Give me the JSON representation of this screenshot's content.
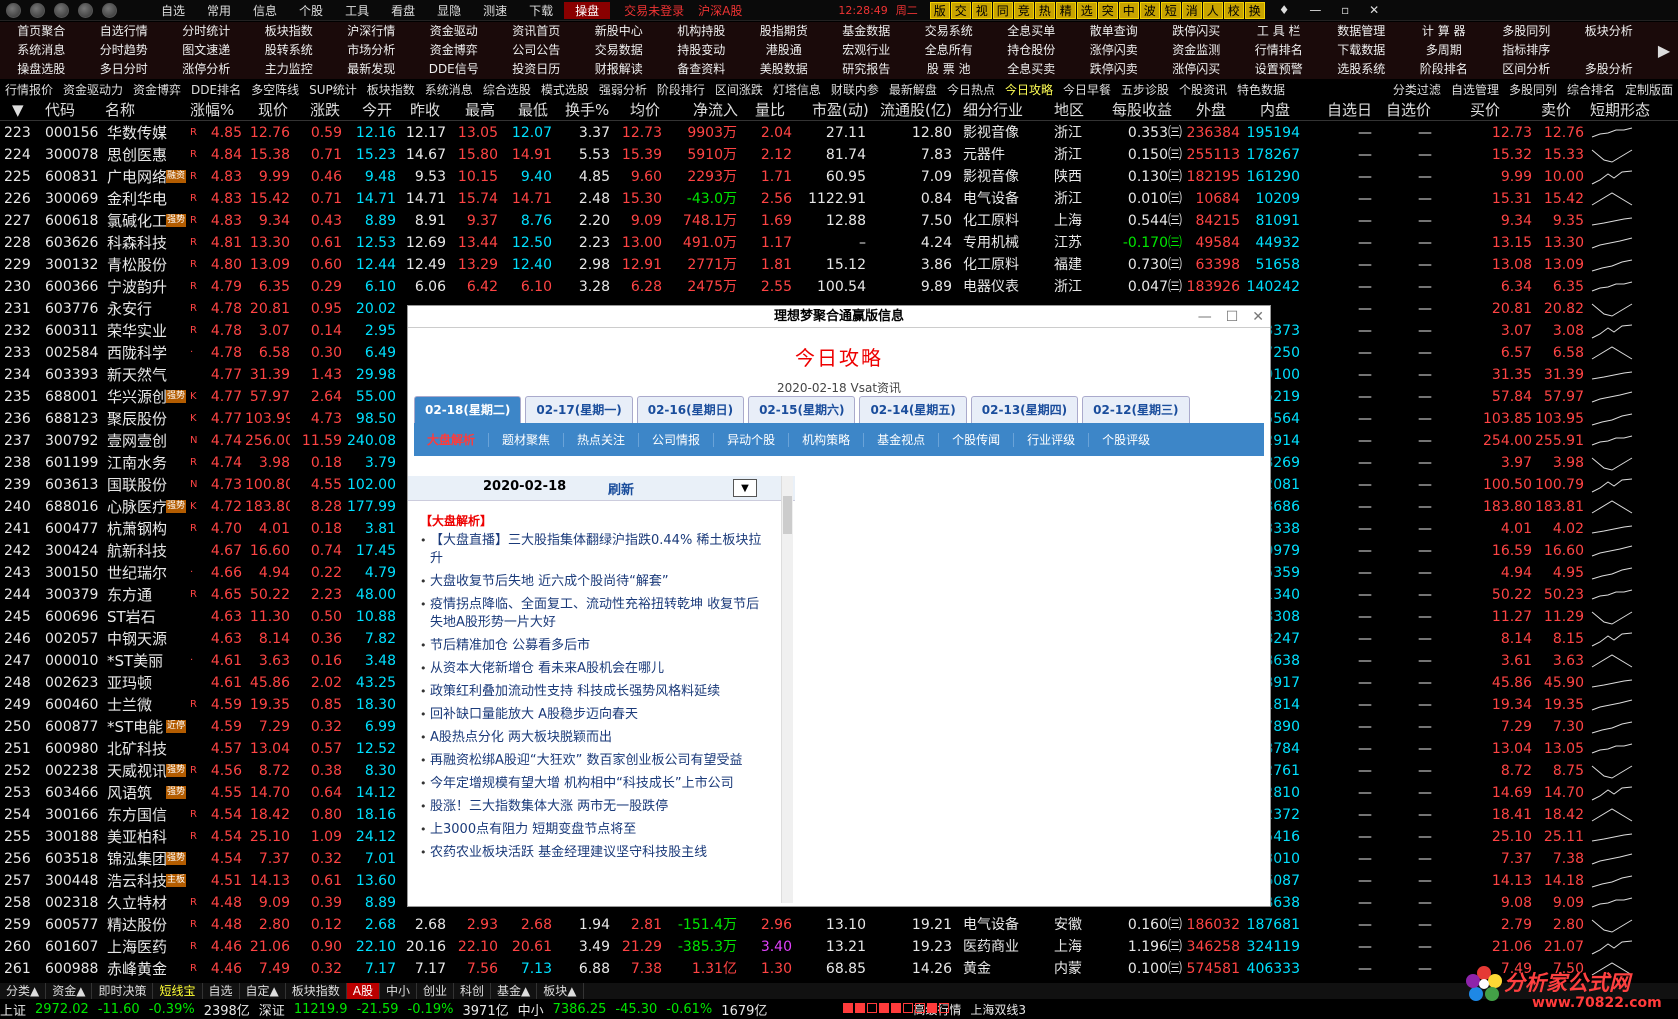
{
  "topbar": {
    "menu": [
      "自选",
      "常用",
      "信息",
      "个股",
      "工具",
      "看盘",
      "显隐",
      "测速",
      "下载",
      "操盘"
    ],
    "active_menu": "操盘",
    "login": "交易未登录",
    "market": "沪深A股",
    "time": "12:28:49",
    "weekday": "周二",
    "quick_buttons": [
      "版",
      "交",
      "视",
      "同",
      "竞",
      "热",
      "精",
      "选",
      "突",
      "中",
      "波",
      "短",
      "消",
      "人",
      "校",
      "换"
    ]
  },
  "menu_grid": [
    [
      "首页聚合",
      "自选行情",
      "分时统计",
      "板块指数",
      "沪深行情",
      "资金驱动",
      "资讯首页",
      "新股中心",
      "机构持股",
      "股指期货",
      "基金数据",
      "交易系统",
      "全息买单",
      "散单查询",
      "跌停闪买",
      "工 具 栏",
      "数据管理",
      "计 算 器",
      "多股同列",
      "板块分析"
    ],
    [
      "系统消息",
      "分时趋势",
      "图文速递",
      "股转系统",
      "市场分析",
      "资金博弈",
      "公司公告",
      "交易数据",
      "持股变动",
      "港股通",
      "宏观行业",
      "全息所有",
      "持仓股份",
      "涨停闪卖",
      "资金监测",
      "行情排名",
      "下载数据",
      "多周期",
      "指标排序",
      ""
    ],
    [
      "操盘选股",
      "多日分时",
      "涨停分析",
      "主力监控",
      "最新发现",
      "DDE信号",
      "投资日历",
      "财报解读",
      "备查资料",
      "美股数据",
      "研究报告",
      "股 票 池",
      "全息买卖",
      "跌停闪卖",
      "涨停闪买",
      "设置预警",
      "选股系统",
      "阶段排名",
      "区间分析",
      "多股分析"
    ]
  ],
  "subbar_left": [
    "行情报价",
    "资金驱动力",
    "资金博弈",
    "DDE排名",
    "多空阵线",
    "SUP统计",
    "板块指数",
    "系统消息",
    "综合选股",
    "模式选股",
    "强弱分析",
    "阶段排行",
    "区间涨跌",
    "灯塔信息",
    "财联内参",
    "最新解盘",
    "今日热点",
    "今日攻略",
    "今日早餐",
    "五步诊股",
    "个股资讯",
    "特色数据"
  ],
  "subbar_active": "今日攻略",
  "subbar_right": [
    "分类过滤",
    "自选管理",
    "多股同列",
    "综合排名",
    "定制版面"
  ],
  "table_headers": [
    "代码",
    "名称",
    "涨幅%",
    "现价",
    "涨跌",
    "今开",
    "昨收",
    "最高",
    "最低",
    "换手%",
    "均价",
    "净流入",
    "量比",
    "市盈(动)",
    "流通股(亿)",
    "细分行业",
    "地区",
    "每股收益",
    "外盘",
    "内盘",
    "自选日",
    "自选价",
    "买价",
    "卖价",
    "短期形态"
  ],
  "rows": [
    {
      "n": "223",
      "code": "000156",
      "name": "华数传媒",
      "mark": "R",
      "pct": "4.85",
      "price": "12.76",
      "chg": "0.59",
      "open": "12.16",
      "prev": "12.17",
      "high": "13.05",
      "low": "12.07",
      "turn": "3.37",
      "avg": "12.73",
      "flow": "9903万",
      "vr": "2.04",
      "pe": "27.11",
      "fl": "12.80",
      "ind": "影视音像",
      "area": "浙江",
      "eps": "0.353㈢",
      "out": "236384",
      "in": "195194",
      "buy": "12.73",
      "sell": "12.76"
    },
    {
      "n": "224",
      "code": "300078",
      "name": "思创医惠",
      "mark": "R",
      "pct": "4.84",
      "price": "15.38",
      "chg": "0.71",
      "open": "15.23",
      "prev": "14.67",
      "high": "15.80",
      "low": "14.91",
      "turn": "5.53",
      "avg": "15.39",
      "flow": "5910万",
      "vr": "2.12",
      "pe": "81.74",
      "fl": "7.83",
      "ind": "元器件",
      "area": "浙江",
      "eps": "0.150㈢",
      "out": "255113",
      "in": "178267",
      "buy": "15.32",
      "sell": "15.33"
    },
    {
      "n": "225",
      "code": "600831",
      "name": "广电网络",
      "tag": "融资",
      "mark": "R",
      "pct": "4.83",
      "price": "9.99",
      "chg": "0.46",
      "open": "9.48",
      "prev": "9.53",
      "high": "10.15",
      "low": "9.40",
      "turn": "4.85",
      "avg": "9.60",
      "flow": "2293万",
      "vr": "1.71",
      "pe": "60.95",
      "fl": "7.09",
      "ind": "影视音像",
      "area": "陕西",
      "eps": "0.130㈢",
      "out": "182195",
      "in": "161290",
      "buy": "9.99",
      "sell": "10.00"
    },
    {
      "n": "226",
      "code": "300069",
      "name": "金利华电",
      "mark": "R",
      "pct": "4.83",
      "price": "15.42",
      "chg": "0.71",
      "open": "14.71",
      "prev": "14.71",
      "high": "15.74",
      "low": "14.71",
      "turn": "2.48",
      "avg": "15.30",
      "flow": "-43.0万",
      "vr": "2.56",
      "pe": "1122.91",
      "fl": "0.84",
      "ind": "电气设备",
      "area": "浙江",
      "eps": "0.010㈢",
      "out": "10684",
      "in": "10209",
      "buy": "15.31",
      "sell": "15.42"
    },
    {
      "n": "227",
      "code": "600618",
      "name": "氯碱化工",
      "tag": "强势",
      "mark": "R",
      "pct": "4.83",
      "price": "9.34",
      "chg": "0.43",
      "open": "8.89",
      "prev": "8.91",
      "high": "9.37",
      "low": "8.76",
      "turn": "2.20",
      "avg": "9.09",
      "flow": "748.1万",
      "vr": "1.69",
      "pe": "12.88",
      "fl": "7.50",
      "ind": "化工原料",
      "area": "上海",
      "eps": "0.544㈢",
      "out": "84215",
      "in": "81091",
      "buy": "9.34",
      "sell": "9.35"
    },
    {
      "n": "228",
      "code": "603626",
      "name": "科森科技",
      "mark": "R",
      "pct": "4.81",
      "price": "13.30",
      "chg": "0.61",
      "open": "12.53",
      "prev": "12.69",
      "high": "13.44",
      "low": "12.50",
      "turn": "2.23",
      "avg": "13.00",
      "flow": "491.0万",
      "vr": "1.17",
      "pe": "–",
      "fl": "4.24",
      "ind": "专用机械",
      "area": "江苏",
      "eps": "-0.170㈢",
      "out": "49584",
      "in": "44932",
      "buy": "13.15",
      "sell": "13.30"
    },
    {
      "n": "229",
      "code": "300132",
      "name": "青松股份",
      "mark": "R",
      "pct": "4.80",
      "price": "13.09",
      "chg": "0.60",
      "open": "12.44",
      "prev": "12.49",
      "high": "13.29",
      "low": "12.40",
      "turn": "2.98",
      "avg": "12.91",
      "flow": "2771万",
      "vr": "1.81",
      "pe": "15.12",
      "fl": "3.86",
      "ind": "化工原料",
      "area": "福建",
      "eps": "0.730㈢",
      "out": "63398",
      "in": "51658",
      "buy": "13.08",
      "sell": "13.09"
    },
    {
      "n": "230",
      "code": "600366",
      "name": "宁波韵升",
      "mark": "R",
      "pct": "4.79",
      "price": "6.35",
      "chg": "0.29",
      "open": "6.10",
      "prev": "6.06",
      "high": "6.42",
      "low": "6.10",
      "turn": "3.28",
      "avg": "6.28",
      "flow": "2475万",
      "vr": "2.55",
      "pe": "100.54",
      "fl": "9.89",
      "ind": "电器仪表",
      "area": "浙江",
      "eps": "0.047㈢",
      "out": "183926",
      "in": "140242",
      "buy": "6.34",
      "sell": "6.35"
    },
    {
      "n": "231",
      "code": "603776",
      "name": "永安行",
      "mark": "R",
      "pct": "4.78",
      "price": "20.81",
      "chg": "0.95",
      "open": "20.02",
      "buy": "20.81",
      "sell": "20.82"
    },
    {
      "n": "232",
      "code": "600311",
      "name": "荣华实业",
      "mark": "R",
      "pct": "4.78",
      "price": "3.07",
      "chg": "0.14",
      "open": "2.95",
      "in": "3373",
      "buy": "3.07",
      "sell": "3.08"
    },
    {
      "n": "233",
      "code": "002584",
      "name": "西陇科学",
      "mark": "·",
      "pct": "4.78",
      "price": "6.58",
      "chg": "0.30",
      "open": "6.49",
      "in": "7250",
      "buy": "6.57",
      "sell": "6.58"
    },
    {
      "n": "234",
      "code": "603393",
      "name": "新天然气",
      "pct": "4.77",
      "price": "31.39",
      "chg": "1.43",
      "open": "29.98",
      "in": "9100",
      "buy": "31.35",
      "sell": "31.39"
    },
    {
      "n": "235",
      "code": "688001",
      "name": "华兴源创",
      "tag": "强势",
      "mark": "K",
      "pct": "4.77",
      "price": "57.97",
      "chg": "2.64",
      "open": "55.00",
      "in": "5219",
      "buy": "57.84",
      "sell": "57.97"
    },
    {
      "n": "236",
      "code": "688123",
      "name": "聚辰股份",
      "mark": "K",
      "pct": "4.77",
      "price": "103.99",
      "chg": "4.73",
      "open": "98.50",
      "in": "5564",
      "buy": "103.85",
      "sell": "103.95"
    },
    {
      "n": "237",
      "code": "300792",
      "name": "壹网壹创",
      "mark": "N",
      "pct": "4.74",
      "price": "256.00",
      "chg": "11.59",
      "open": "240.08",
      "in": "2914",
      "buy": "254.00",
      "sell": "255.91"
    },
    {
      "n": "238",
      "code": "601199",
      "name": "江南水务",
      "mark": "R",
      "pct": "4.74",
      "price": "3.98",
      "chg": "0.18",
      "open": "3.79",
      "in": "8269",
      "buy": "3.97",
      "sell": "3.98"
    },
    {
      "n": "239",
      "code": "603613",
      "name": "国联股份",
      "mark": "N",
      "pct": "4.73",
      "price": "100.80",
      "chg": "4.55",
      "open": "102.00",
      "in": "2081",
      "buy": "100.50",
      "sell": "100.79"
    },
    {
      "n": "240",
      "code": "688016",
      "name": "心脉医疗",
      "tag": "强势",
      "mark": "K",
      "pct": "4.72",
      "price": "183.80",
      "chg": "8.28",
      "open": "177.99",
      "in": "8686",
      "buy": "183.80",
      "sell": "183.81"
    },
    {
      "n": "241",
      "code": "600477",
      "name": "杭萧钢构",
      "mark": "R",
      "pct": "4.70",
      "price": "4.01",
      "chg": "0.18",
      "open": "3.81",
      "in": "3338",
      "buy": "4.01",
      "sell": "4.02"
    },
    {
      "n": "242",
      "code": "300424",
      "name": "航新科技",
      "pct": "4.67",
      "price": "16.60",
      "chg": "0.74",
      "open": "17.45",
      "in": "0979",
      "buy": "16.59",
      "sell": "16.60"
    },
    {
      "n": "243",
      "code": "300150",
      "name": "世纪瑞尔",
      "mark": "·",
      "pct": "4.66",
      "price": "4.94",
      "chg": "0.22",
      "open": "4.79",
      "in": "5359",
      "buy": "4.94",
      "sell": "4.95"
    },
    {
      "n": "244",
      "code": "300379",
      "name": "东方通",
      "mark": "R",
      "pct": "4.65",
      "price": "50.22",
      "chg": "2.23",
      "open": "48.00",
      "in": "1340",
      "buy": "50.22",
      "sell": "50.23"
    },
    {
      "n": "245",
      "code": "600696",
      "name": "ST岩石",
      "pct": "4.63",
      "price": "11.30",
      "chg": "0.50",
      "open": "10.88",
      "in": "8308",
      "buy": "11.27",
      "sell": "11.29"
    },
    {
      "n": "246",
      "code": "002057",
      "name": "中钢天源",
      "pct": "4.63",
      "price": "8.14",
      "chg": "0.36",
      "open": "7.82",
      "in": "8247",
      "buy": "8.14",
      "sell": "8.15"
    },
    {
      "n": "247",
      "code": "000010",
      "name": "*ST美丽",
      "mark": "·",
      "pct": "4.61",
      "price": "3.63",
      "chg": "0.16",
      "open": "3.48",
      "in": "8638",
      "buy": "3.61",
      "sell": "3.63"
    },
    {
      "n": "248",
      "code": "002623",
      "name": "亚玛顿",
      "pct": "4.61",
      "price": "45.86",
      "chg": "2.02",
      "open": "43.25",
      "in": "8917",
      "buy": "45.86",
      "sell": "45.90"
    },
    {
      "n": "249",
      "code": "600460",
      "name": "士兰微",
      "mark": "R",
      "pct": "4.59",
      "price": "19.35",
      "chg": "0.85",
      "open": "18.30",
      "in": "1814",
      "buy": "19.34",
      "sell": "19.35"
    },
    {
      "n": "250",
      "code": "600877",
      "name": "*ST电能",
      "tag": "近停",
      "pct": "4.59",
      "price": "7.29",
      "chg": "0.32",
      "open": "6.99",
      "in": "7890",
      "buy": "7.29",
      "sell": "7.30"
    },
    {
      "n": "251",
      "code": "600980",
      "name": "北矿科技",
      "pct": "4.57",
      "price": "13.04",
      "chg": "0.57",
      "open": "12.52",
      "in": "8784",
      "buy": "13.04",
      "sell": "13.05"
    },
    {
      "n": "252",
      "code": "002238",
      "name": "天威视讯",
      "tag": "强势",
      "mark": "R",
      "pct": "4.56",
      "price": "8.72",
      "chg": "0.38",
      "open": "8.30",
      "in": "2761",
      "buy": "8.72",
      "sell": "8.75"
    },
    {
      "n": "253",
      "code": "603466",
      "name": "风语筑",
      "tag": "强势",
      "pct": "4.55",
      "price": "14.70",
      "chg": "0.64",
      "open": "14.12",
      "in": "2810",
      "buy": "14.69",
      "sell": "14.70"
    },
    {
      "n": "254",
      "code": "300166",
      "name": "东方国信",
      "mark": "R",
      "pct": "4.54",
      "price": "18.42",
      "chg": "0.80",
      "open": "18.16",
      "in": "2372",
      "buy": "18.41",
      "sell": "18.42"
    },
    {
      "n": "255",
      "code": "300188",
      "name": "美亚柏科",
      "mark": "R",
      "pct": "4.54",
      "price": "25.10",
      "chg": "1.09",
      "open": "24.12",
      "in": "5416",
      "buy": "25.10",
      "sell": "25.11"
    },
    {
      "n": "256",
      "code": "603518",
      "name": "锦泓集团",
      "tag": "强势",
      "pct": "4.54",
      "price": "7.37",
      "chg": "0.32",
      "open": "7.01",
      "in": "3010",
      "buy": "7.37",
      "sell": "7.38"
    },
    {
      "n": "257",
      "code": "300448",
      "name": "浩云科技",
      "tag": "主板",
      "pct": "4.51",
      "price": "14.13",
      "chg": "0.61",
      "open": "13.60",
      "in": "6087",
      "buy": "14.13",
      "sell": "14.18"
    },
    {
      "n": "258",
      "code": "002318",
      "name": "久立特材",
      "mark": "R",
      "pct": "4.48",
      "price": "9.09",
      "chg": "0.39",
      "open": "8.89",
      "in": "8638",
      "buy": "9.08",
      "sell": "9.09"
    },
    {
      "n": "259",
      "code": "600577",
      "name": "精达股份",
      "mark": "R",
      "pct": "4.48",
      "price": "2.80",
      "chg": "0.12",
      "open": "2.68",
      "prev": "2.68",
      "high": "2.93",
      "low": "2.68",
      "turn": "1.94",
      "avg": "2.81",
      "flow": "-151.4万",
      "vr": "2.96",
      "pe": "13.10",
      "fl": "19.21",
      "ind": "电气设备",
      "area": "安徽",
      "eps": "0.160㈢",
      "out": "186032",
      "in": "187681",
      "buy": "2.79",
      "sell": "2.80"
    },
    {
      "n": "260",
      "code": "601607",
      "name": "上海医药",
      "mark": "R",
      "pct": "4.46",
      "price": "21.06",
      "chg": "0.90",
      "open": "22.10",
      "prev": "20.16",
      "high": "22.10",
      "low": "20.61",
      "turn": "3.49",
      "avg": "21.29",
      "flow": "-385.3万",
      "vr": "3.40",
      "pe": "13.21",
      "fl": "19.23",
      "ind": "医药商业",
      "area": "上海",
      "eps": "1.196㈢",
      "out": "346258",
      "in": "324119",
      "buy": "21.06",
      "sell": "21.07"
    },
    {
      "n": "261",
      "code": "600988",
      "name": "赤峰黄金",
      "mark": "R",
      "pct": "4.46",
      "price": "7.49",
      "chg": "0.32",
      "open": "7.17",
      "prev": "7.17",
      "high": "7.56",
      "low": "7.13",
      "turn": "6.88",
      "avg": "7.38",
      "flow": "1.31亿",
      "vr": "1.30",
      "pe": "68.85",
      "fl": "14.26",
      "ind": "黄金",
      "area": "内蒙",
      "eps": "0.100㈢",
      "out": "574581",
      "in": "406333",
      "buy": "7.49",
      "sell": "7.50"
    }
  ],
  "dialog": {
    "title": "理想梦聚合通赢版信息",
    "heading": "今日攻略",
    "subheading": "2020-02-18 Vsat资讯",
    "date_tabs": [
      "02-18(星期二)",
      "02-17(星期一)",
      "02-16(星期日)",
      "02-15(星期六)",
      "02-14(星期五)",
      "02-13(星期四)",
      "02-12(星期三)"
    ],
    "cat_tabs": [
      "大盘解析",
      "题材聚焦",
      "热点关注",
      "公司情报",
      "异动个股",
      "机构策略",
      "基金视点",
      "个股传闻",
      "行业评级",
      "个股评级"
    ],
    "list_date": "2020-02-18",
    "refresh": "刷新",
    "section": "【大盘解析】",
    "items": [
      "【大盘直播】三大股指集体翻绿沪指跌0.44% 稀土板块拉升",
      "大盘收复节后失地 近六成个股尚待“解套”",
      "疫情拐点降临、全面复工、流动性充裕扭转乾坤 收复节后失地A股形势一片大好",
      "节后精准加仓 公募看多后市",
      "从资本大佬新增仓 看未来A股机会在哪儿",
      "政策红利叠加流动性支持 科技成长强势风格料延续",
      "回补缺口量能放大 A股稳步迈向春天",
      "A股热点分化 两大板块脱颖而出",
      "再融资松绑A股迎“大狂欢” 数百家创业板公司有望受益",
      "今年定增规模有望大增 机构相中“科技成长”上市公司",
      "股涨！三大指数集体大涨 两市无一股跌停",
      "上3000点有阻力 短期变盘节点将至",
      "农药农业板块活跃 基金经理建议坚守科技股主线"
    ]
  },
  "bottom_tabs": [
    "分类▲",
    "资金▲",
    "即时决策",
    "短线宝",
    "自选",
    "自定▲",
    "板块指数",
    "A股",
    "中小",
    "创业",
    "科创",
    "基金▲",
    "板块▲"
  ],
  "status": {
    "sh_label": "上证",
    "sh_val": "2972.02",
    "sh_chg": "-11.60",
    "sh_pct": "-0.39%",
    "sh_amt": "2398亿",
    "sz_label": "深证",
    "sz_val": "11219.9",
    "sz_chg": "-21.59",
    "sz_pct": "-0.19%",
    "sz_amt": "3971亿",
    "zx_label": "中小",
    "zx_val": "7386.25",
    "zx_chg": "-45.30",
    "zx_pct": "-0.61%",
    "zx_amt": "1679亿",
    "feed1": "高级行情",
    "feed2": "上海双线3"
  },
  "logo": {
    "title": "分析家公式网",
    "url": "www.70822.com"
  },
  "colors": {
    "up": "#ff4444",
    "down": "#00e600",
    "accent": "#3d86c8",
    "tag": "#b35c00"
  }
}
